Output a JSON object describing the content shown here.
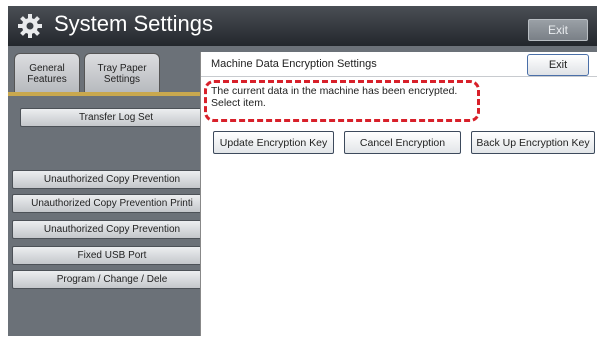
{
  "header": {
    "title": "System Settings",
    "exit_label": "Exit",
    "icon": "gear-icon"
  },
  "tabs": [
    {
      "label": "General\nFeatures"
    },
    {
      "label": "Tray Paper\nSettings"
    }
  ],
  "left_buttons": [
    {
      "label": "Transfer Log Set"
    },
    {
      "label": "Unauthorized Copy Prevention"
    },
    {
      "label": "Unauthorized Copy Prevention Printi"
    },
    {
      "label": "Unauthorized Copy Prevention"
    },
    {
      "label": "Fixed USB Port"
    },
    {
      "label": "Program / Change / Dele"
    }
  ],
  "dialog": {
    "title": "Machine Data Encryption Settings",
    "exit_label": "Exit",
    "message_line1": "The current data in the machine has been encrypted.",
    "message_line2": "Select item.",
    "buttons": [
      {
        "label": "Update Encryption Key"
      },
      {
        "label": "Cancel Encryption"
      },
      {
        "label": "Back Up Encryption Key"
      }
    ]
  },
  "colors": {
    "highlight": "#d8202a",
    "title_bar": "#2b2f34",
    "tab_accent": "#c9a84e"
  }
}
